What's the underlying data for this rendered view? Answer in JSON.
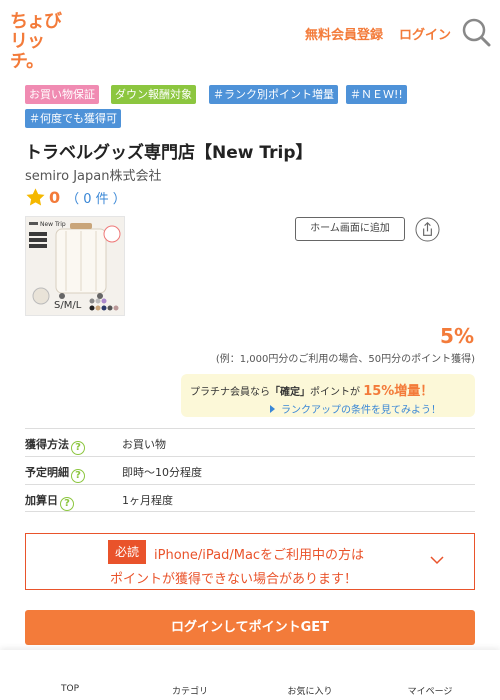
{
  "header": {
    "logo_line1": "ちょび",
    "logo_line2": "リッチ。",
    "register_label": "無料会員登録",
    "login_label": "ログイン",
    "search_icon": "search-icon",
    "accent_color": "#f37b3a"
  },
  "tags": [
    {
      "label": "お買い物保証",
      "color": "#f08bb2"
    },
    {
      "label": "ダウン報酬対象",
      "color": "#8cc63f"
    },
    {
      "label": "＃ランク別ポイント増量",
      "color": "#4e92d8"
    },
    {
      "label": "＃ＮＥＷ!!",
      "color": "#4e92d8"
    },
    {
      "label": "＃何度でも獲得可",
      "color": "#4e92d8"
    }
  ],
  "shop": {
    "title": "トラベルグッズ専門店【New Trip】",
    "company": "semiro Japan株式会社",
    "rating_value": "0",
    "rating_count": "（ 0 件 ）",
    "thumb_brand": "New Trip",
    "thumb_size": "S/M/L"
  },
  "actions": {
    "home_screen_label": "ホーム画面に追加",
    "share_icon": "share-icon"
  },
  "reward": {
    "rate": "5%",
    "example": "(例：1,000円分のご利用の場合、50円分のポイント獲得)",
    "plat_prefix": "プラチナ会員なら",
    "plat_fixed": "「確定」",
    "plat_mid": "ポイントが",
    "plat_boost": "15%増量！",
    "plat_link": "ランクアップの条件を見てみよう！"
  },
  "info": [
    {
      "label": "獲得方法",
      "value": "お買い物"
    },
    {
      "label": "予定明細",
      "value": "即時～10分程度"
    },
    {
      "label": "加算日",
      "value": "1ヶ月程度"
    }
  ],
  "notice": {
    "badge": "必読",
    "line1": "iPhone/iPad/Macをご利用中の方は",
    "line2": "ポイントが獲得できない場合があります！"
  },
  "cta_label": "ログインしてポイントGET",
  "bottom_nav": [
    {
      "label": "TOP"
    },
    {
      "label": "カテゴリ"
    },
    {
      "label": "お気に入り"
    },
    {
      "label": "マイページ"
    }
  ]
}
